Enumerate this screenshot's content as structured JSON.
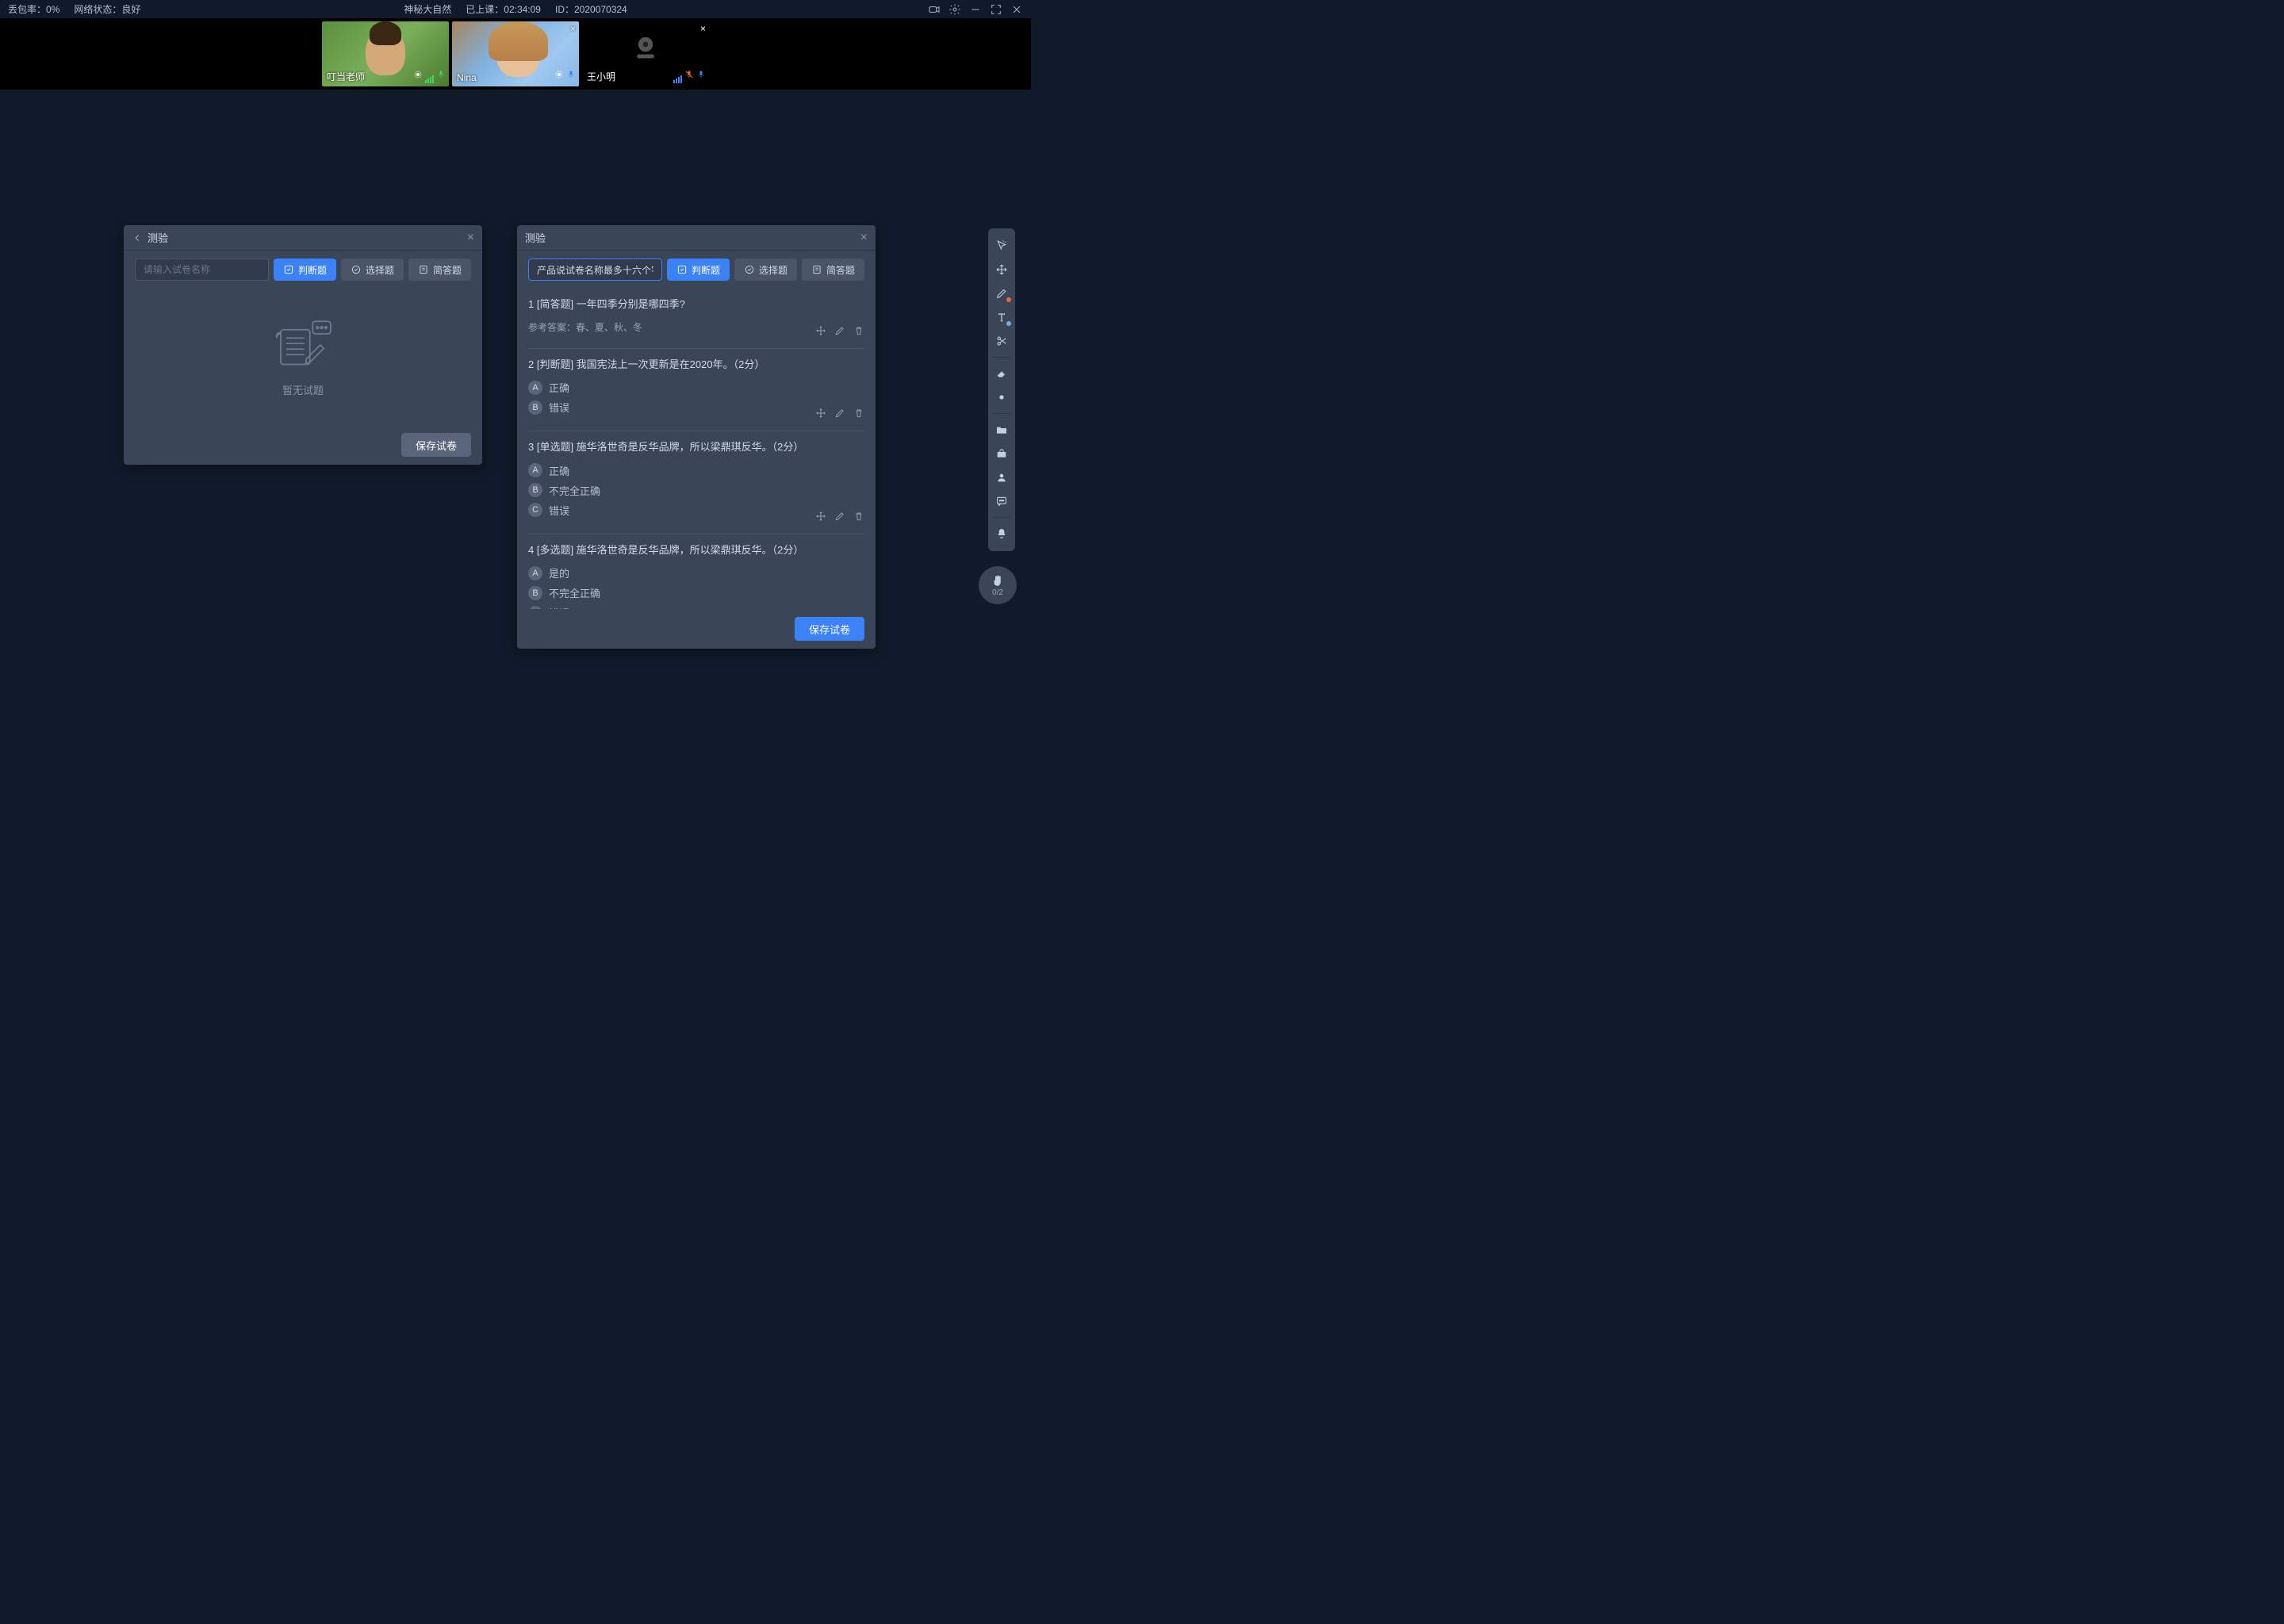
{
  "topbar": {
    "packet_loss_label": "丢包率：0%",
    "network_label": "网络状态：良好",
    "title": "神秘大自然",
    "elapsed_label": "已上课：02:34:09",
    "id_label": "ID：2020070324"
  },
  "videos": [
    {
      "name": "叮当老师",
      "style": "teacher",
      "closable": false
    },
    {
      "name": "Nina",
      "style": "nina",
      "closable": true
    },
    {
      "name": "王小明",
      "style": "off",
      "closable": true
    }
  ],
  "panel_left": {
    "title": "测验",
    "input_placeholder": "请输入试卷名称",
    "tabs": {
      "judge": "判断题",
      "choice": "选择题",
      "short": "简答题"
    },
    "empty_text": "暂无试题",
    "save_btn": "保存试卷"
  },
  "panel_right": {
    "title": "测验",
    "input_value": "产品说试卷名称最多十六个字",
    "tabs": {
      "judge": "判断题",
      "choice": "选择题",
      "short": "简答题"
    },
    "save_btn": "保存试卷",
    "questions": [
      {
        "title": "1 [简答题] 一年四季分别是哪四季?",
        "answer_label": "参考答案：春、夏、秋、冬"
      },
      {
        "title": "2 [判断题] 我国宪法上一次更新是在2020年。（2分）",
        "options": [
          {
            "letter": "A",
            "text": "正确"
          },
          {
            "letter": "B",
            "text": "错误"
          }
        ]
      },
      {
        "title": "3 [单选题] 施华洛世奇是反华品牌，所以梁鼎琪反华。（2分）",
        "options": [
          {
            "letter": "A",
            "text": "正确"
          },
          {
            "letter": "B",
            "text": "不完全正确"
          },
          {
            "letter": "C",
            "text": "错误"
          }
        ]
      },
      {
        "title": "4 [多选题] 施华洛世奇是反华品牌，所以梁鼎琪反华。（2分）",
        "options": [
          {
            "letter": "A",
            "text": "是的"
          },
          {
            "letter": "B",
            "text": "不完全正确"
          },
          {
            "letter": "C",
            "text": "错误"
          }
        ]
      }
    ]
  },
  "hand": {
    "count": "0/2"
  }
}
